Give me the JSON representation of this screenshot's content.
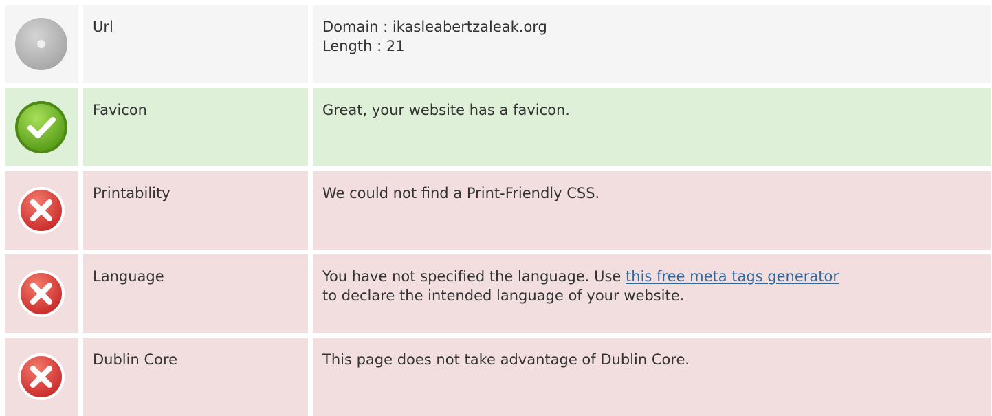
{
  "rows": [
    {
      "status": "neutral",
      "icon": "neutral-disc-icon",
      "label": "Url",
      "lines": [
        "Domain : ikasleabertzaleak.org",
        "Length : 21"
      ]
    },
    {
      "status": "pass",
      "icon": "check-circle-icon",
      "label": "Favicon",
      "text": "Great, your website has a favicon."
    },
    {
      "status": "fail",
      "icon": "error-x-icon",
      "label": "Printability",
      "text": "We could not find a Print-Friendly CSS."
    },
    {
      "status": "fail",
      "icon": "error-x-icon",
      "label": "Language",
      "text_before": "You have not specified the language. Use ",
      "link_text": "this free meta tags generator",
      "text_after": "to declare the intended language of your website."
    },
    {
      "status": "fail",
      "icon": "error-x-icon",
      "label": "Dublin Core",
      "text": "This page does not take advantage of Dublin Core."
    }
  ],
  "colors": {
    "neutral_bg": "#f5f5f5",
    "pass_bg": "#dff0d8",
    "fail_bg": "#f2dede",
    "link": "#336699",
    "pass_icon": "#7cc22c",
    "fail_icon": "#e03a3a",
    "neutral_icon": "#b0b0b0"
  }
}
